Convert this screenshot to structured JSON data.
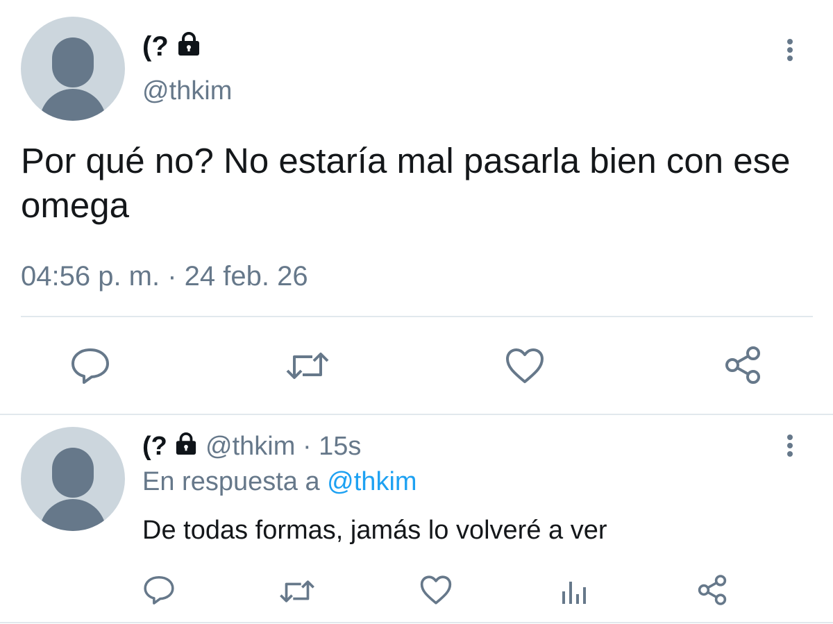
{
  "main_tweet": {
    "display_name": "(?",
    "handle": "@thkim",
    "text": "Por qué no? No estaría mal pasarla bien con ese omega",
    "timestamp": "04:56 p. m. · 24 feb. 26",
    "protected_icon": "lock-icon",
    "actions": [
      "reply-icon",
      "retweet-icon",
      "like-icon",
      "share-icon"
    ]
  },
  "reply_tweet": {
    "display_name": "(?",
    "handle": "@thkim",
    "time_ago": "15s",
    "separator": "·",
    "replying_prefix": "En respuesta a",
    "replying_to": "@thkim",
    "text": "De todas formas, jamás lo volveré a ver",
    "protected_icon": "lock-icon",
    "actions": [
      "reply-icon",
      "retweet-icon",
      "like-icon",
      "analytics-icon",
      "share-icon"
    ]
  },
  "colors": {
    "secondary_text": "#66788a",
    "mention": "#1da1f2",
    "avatar_bg": "#ccd6dd",
    "avatar_fg": "#66788a",
    "divider": "#e1e8ed"
  }
}
